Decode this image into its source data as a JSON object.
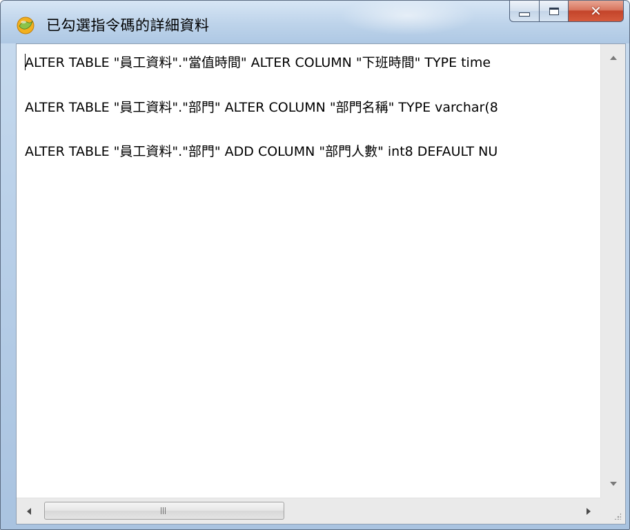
{
  "window": {
    "title": "已勾選指令碼的詳細資料",
    "icon": "navicat-icon",
    "buttons": {
      "minimize": "minimize-icon",
      "maximize": "maximize-icon",
      "close": "close-icon"
    }
  },
  "content": {
    "lines": [
      "ALTER TABLE \"員工資料\".\"當值時間\" ALTER COLUMN \"下班時間\" TYPE time",
      "ALTER TABLE \"員工資料\".\"部門\" ALTER COLUMN \"部門名稱\" TYPE varchar(8",
      "ALTER TABLE \"員工資料\".\"部門\" ADD COLUMN \"部門人數\" int8 DEFAULT NU"
    ]
  },
  "colors": {
    "close_button": "#c3442a",
    "frame": "#b8cfe8"
  }
}
